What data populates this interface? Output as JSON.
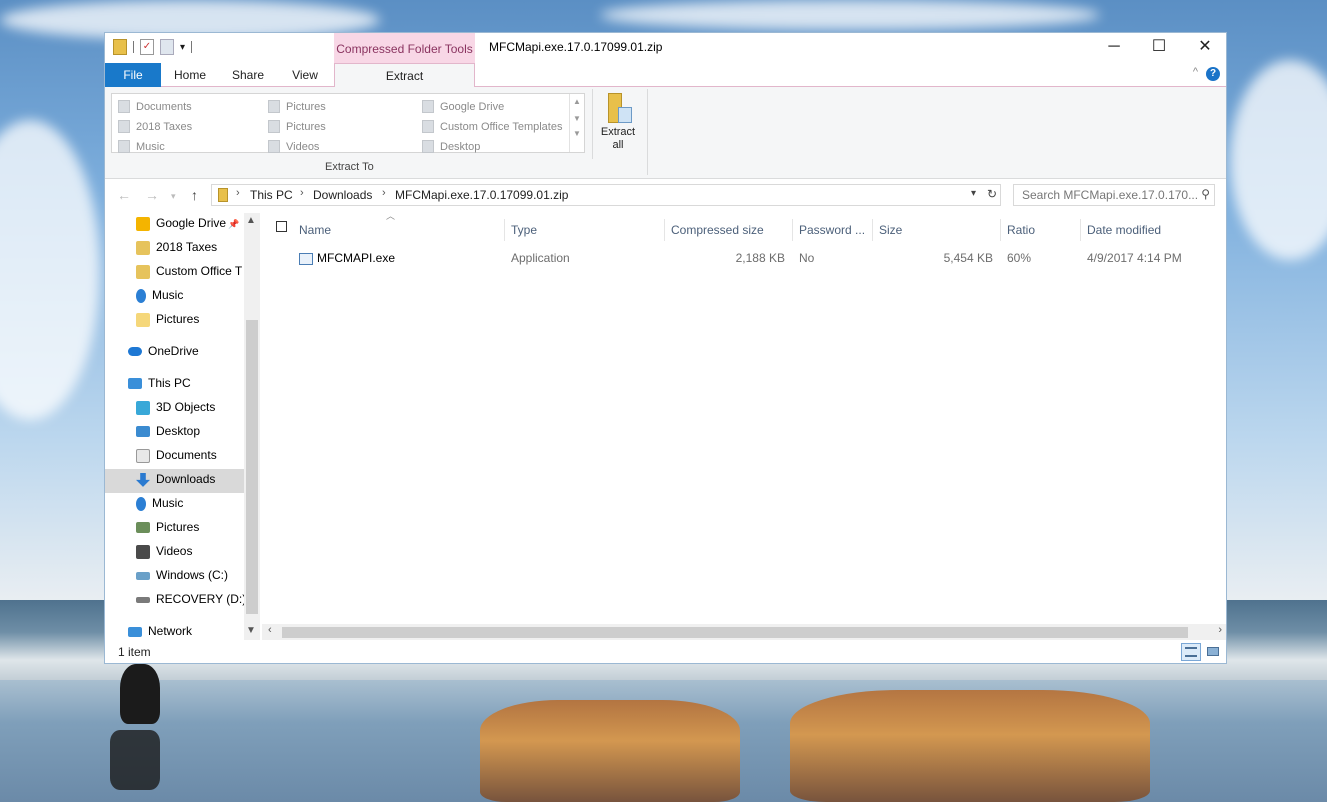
{
  "window": {
    "title": "MFCMapi.exe.17.0.17099.01.zip",
    "contextual_group": "Compressed Folder Tools",
    "controls": {
      "minimize": "─",
      "maximize": "☐",
      "close": "✕"
    }
  },
  "ribbon": {
    "tabs": {
      "file": "File",
      "home": "Home",
      "share": "Share",
      "view": "View",
      "extract": "Extract"
    },
    "collapse_glyph": "^",
    "help_glyph": "?",
    "extract_to": {
      "group_label": "Extract To",
      "items": [
        "Documents",
        "Pictures",
        "Google Drive",
        "2018 Taxes",
        "Pictures",
        "Custom Office Templates",
        "Music",
        "Videos",
        "Desktop"
      ]
    },
    "extract_all": {
      "line1": "Extract",
      "line2": "all"
    }
  },
  "address": {
    "crumbs": [
      "This PC",
      "Downloads",
      "MFCMapi.exe.17.0.17099.01.zip"
    ],
    "search_placeholder": "Search MFCMapi.exe.17.0.170..."
  },
  "nav": {
    "items": [
      {
        "label": "Google Drive",
        "icon": "google-drive-icon",
        "color": "#f4b400",
        "pinned": true
      },
      {
        "label": "2018 Taxes",
        "icon": "folder-icon",
        "color": "#e6c35c"
      },
      {
        "label": "Custom Office T",
        "icon": "folder-icon",
        "color": "#e6c35c"
      },
      {
        "label": "Music",
        "icon": "music-icon",
        "color": "#2b7fd4"
      },
      {
        "label": "Pictures",
        "icon": "folder-icon",
        "color": "#f5d77a"
      },
      {
        "label": "OneDrive",
        "icon": "onedrive-icon",
        "color": "#1e78d4"
      },
      {
        "label": "This PC",
        "icon": "computer-icon",
        "color": "#3a8fd9"
      },
      {
        "label": "3D Objects",
        "icon": "cube-icon",
        "color": "#38a8d8"
      },
      {
        "label": "Desktop",
        "icon": "desktop-icon",
        "color": "#3b8bd0"
      },
      {
        "label": "Documents",
        "icon": "documents-icon",
        "color": "#a0a0a0"
      },
      {
        "label": "Downloads",
        "icon": "download-icon",
        "color": "#2a7ad0"
      },
      {
        "label": "Music",
        "icon": "music-icon",
        "color": "#2b7fd4"
      },
      {
        "label": "Pictures",
        "icon": "pictures-icon",
        "color": "#6b8e5a"
      },
      {
        "label": "Videos",
        "icon": "videos-icon",
        "color": "#4a4a4a"
      },
      {
        "label": "Windows (C:)",
        "icon": "drive-icon",
        "color": "#6aa0c8"
      },
      {
        "label": "RECOVERY (D:)",
        "icon": "drive-icon",
        "color": "#7a7a7a"
      },
      {
        "label": "Network",
        "icon": "network-icon",
        "color": "#3a8fd9"
      }
    ]
  },
  "columns": [
    "Name",
    "Type",
    "Compressed size",
    "Password ...",
    "Size",
    "Ratio",
    "Date modified"
  ],
  "files": [
    {
      "name": "MFCMAPI.exe",
      "type": "Application",
      "compressed": "2,188 KB",
      "password": "No",
      "size": "5,454 KB",
      "ratio": "60%",
      "modified": "4/9/2017 4:14 PM"
    }
  ],
  "status": {
    "count": "1 item"
  }
}
